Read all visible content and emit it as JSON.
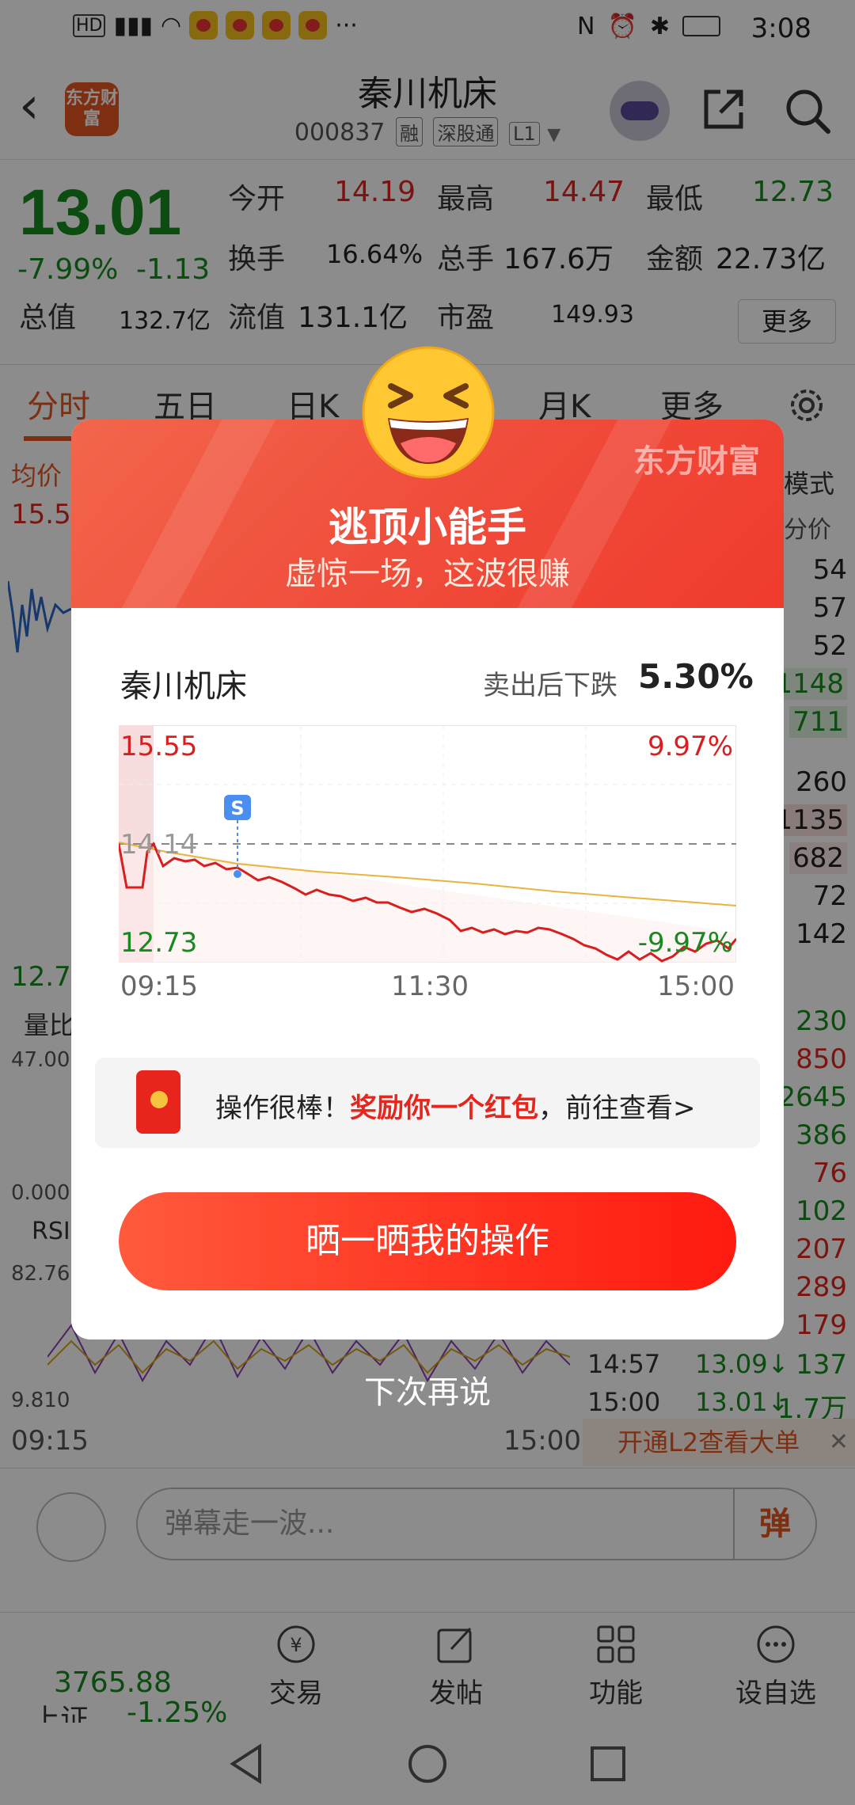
{
  "status_bar": {
    "time": "3:08"
  },
  "header": {
    "title": "秦川机床",
    "code": "000837",
    "tags": [
      "融",
      "深股通",
      "L1"
    ],
    "logo_text": "东方财富"
  },
  "quote": {
    "price": "13.01",
    "change_pct": "-7.99%",
    "change": "-1.13",
    "items": [
      {
        "label": "今开",
        "value": "14.19"
      },
      {
        "label": "最高",
        "value": "14.47"
      },
      {
        "label": "最低",
        "value": "12.73"
      },
      {
        "label": "换手",
        "value": "16.64%"
      },
      {
        "label": "总手",
        "value": "167.6万"
      },
      {
        "label": "金额",
        "value": "22.73亿"
      },
      {
        "label": "总值",
        "value": "132.7亿"
      },
      {
        "label": "流值",
        "value": "131.1亿"
      },
      {
        "label": "市盈",
        "value": "149.93"
      }
    ],
    "more_label": "更多"
  },
  "tabs": [
    "分时",
    "五日",
    "日K",
    "月K",
    "更多"
  ],
  "background": {
    "left_labels": [
      "均价",
      "15.5",
      "12.7",
      "量比",
      "47.00",
      "0.000",
      "RSI",
      "82.76",
      "9.810"
    ],
    "x_start": "09:15",
    "x_end": "15:00",
    "mode_label": "模式",
    "price_label": "分价",
    "side_values": [
      "54",
      "57",
      "52",
      "1148",
      "711",
      "260",
      "1135",
      "682",
      "72",
      "142",
      "230",
      "850",
      "2645",
      "386",
      "76",
      "102",
      "207",
      "289",
      "179"
    ],
    "ticks": [
      {
        "time": "14:57",
        "price": "13.09↓",
        "vol": "137"
      },
      {
        "time": "15:00",
        "price": "13.01↓",
        "vol": "1.7万"
      }
    ],
    "banner": "开通L2查看大单"
  },
  "comment": {
    "placeholder": "弹幕走一波...",
    "danmu": "弹"
  },
  "bottom_nav": {
    "index_value": "3765.88",
    "index_name": "上证",
    "index_change": "-1.25%",
    "items": [
      "交易",
      "发帖",
      "功能",
      "设自选"
    ]
  },
  "dialog": {
    "brand": "东方财富",
    "title": "逃顶小能手",
    "subtitle": "虚惊一场，这波很赚",
    "stock_name": "秦川机床",
    "after_sell_label": "卖出后下跌",
    "after_sell_value": "5.30%",
    "chart": {
      "y_high": "15.55",
      "y_mid": "14.14",
      "y_low": "12.73",
      "pct_high": "9.97%",
      "pct_low": "-9.97%",
      "sell_marker": "S",
      "x_labels": [
        "09:15",
        "11:30",
        "15:00"
      ]
    },
    "reward_prefix": "操作很棒！",
    "reward_highlight": "奖励你一个红包",
    "reward_suffix": "，前往查看>",
    "share_button": "晒一晒我的操作",
    "dismiss": "下次再说"
  }
}
